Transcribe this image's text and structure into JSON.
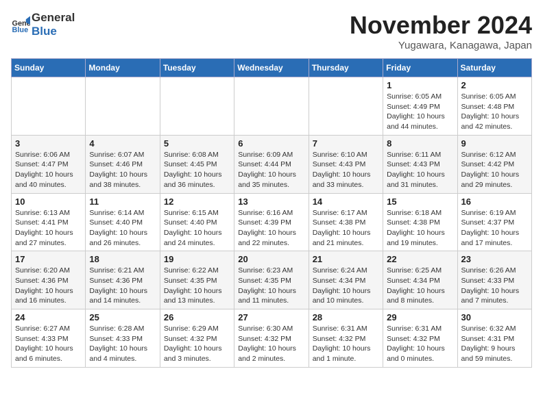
{
  "logo": {
    "line1": "General",
    "line2": "Blue"
  },
  "title": "November 2024",
  "subtitle": "Yugawara, Kanagawa, Japan",
  "days_of_week": [
    "Sunday",
    "Monday",
    "Tuesday",
    "Wednesday",
    "Thursday",
    "Friday",
    "Saturday"
  ],
  "weeks": [
    [
      {
        "day": "",
        "info": ""
      },
      {
        "day": "",
        "info": ""
      },
      {
        "day": "",
        "info": ""
      },
      {
        "day": "",
        "info": ""
      },
      {
        "day": "",
        "info": ""
      },
      {
        "day": "1",
        "info": "Sunrise: 6:05 AM\nSunset: 4:49 PM\nDaylight: 10 hours and 44 minutes."
      },
      {
        "day": "2",
        "info": "Sunrise: 6:05 AM\nSunset: 4:48 PM\nDaylight: 10 hours and 42 minutes."
      }
    ],
    [
      {
        "day": "3",
        "info": "Sunrise: 6:06 AM\nSunset: 4:47 PM\nDaylight: 10 hours and 40 minutes."
      },
      {
        "day": "4",
        "info": "Sunrise: 6:07 AM\nSunset: 4:46 PM\nDaylight: 10 hours and 38 minutes."
      },
      {
        "day": "5",
        "info": "Sunrise: 6:08 AM\nSunset: 4:45 PM\nDaylight: 10 hours and 36 minutes."
      },
      {
        "day": "6",
        "info": "Sunrise: 6:09 AM\nSunset: 4:44 PM\nDaylight: 10 hours and 35 minutes."
      },
      {
        "day": "7",
        "info": "Sunrise: 6:10 AM\nSunset: 4:43 PM\nDaylight: 10 hours and 33 minutes."
      },
      {
        "day": "8",
        "info": "Sunrise: 6:11 AM\nSunset: 4:43 PM\nDaylight: 10 hours and 31 minutes."
      },
      {
        "day": "9",
        "info": "Sunrise: 6:12 AM\nSunset: 4:42 PM\nDaylight: 10 hours and 29 minutes."
      }
    ],
    [
      {
        "day": "10",
        "info": "Sunrise: 6:13 AM\nSunset: 4:41 PM\nDaylight: 10 hours and 27 minutes."
      },
      {
        "day": "11",
        "info": "Sunrise: 6:14 AM\nSunset: 4:40 PM\nDaylight: 10 hours and 26 minutes."
      },
      {
        "day": "12",
        "info": "Sunrise: 6:15 AM\nSunset: 4:40 PM\nDaylight: 10 hours and 24 minutes."
      },
      {
        "day": "13",
        "info": "Sunrise: 6:16 AM\nSunset: 4:39 PM\nDaylight: 10 hours and 22 minutes."
      },
      {
        "day": "14",
        "info": "Sunrise: 6:17 AM\nSunset: 4:38 PM\nDaylight: 10 hours and 21 minutes."
      },
      {
        "day": "15",
        "info": "Sunrise: 6:18 AM\nSunset: 4:38 PM\nDaylight: 10 hours and 19 minutes."
      },
      {
        "day": "16",
        "info": "Sunrise: 6:19 AM\nSunset: 4:37 PM\nDaylight: 10 hours and 17 minutes."
      }
    ],
    [
      {
        "day": "17",
        "info": "Sunrise: 6:20 AM\nSunset: 4:36 PM\nDaylight: 10 hours and 16 minutes."
      },
      {
        "day": "18",
        "info": "Sunrise: 6:21 AM\nSunset: 4:36 PM\nDaylight: 10 hours and 14 minutes."
      },
      {
        "day": "19",
        "info": "Sunrise: 6:22 AM\nSunset: 4:35 PM\nDaylight: 10 hours and 13 minutes."
      },
      {
        "day": "20",
        "info": "Sunrise: 6:23 AM\nSunset: 4:35 PM\nDaylight: 10 hours and 11 minutes."
      },
      {
        "day": "21",
        "info": "Sunrise: 6:24 AM\nSunset: 4:34 PM\nDaylight: 10 hours and 10 minutes."
      },
      {
        "day": "22",
        "info": "Sunrise: 6:25 AM\nSunset: 4:34 PM\nDaylight: 10 hours and 8 minutes."
      },
      {
        "day": "23",
        "info": "Sunrise: 6:26 AM\nSunset: 4:33 PM\nDaylight: 10 hours and 7 minutes."
      }
    ],
    [
      {
        "day": "24",
        "info": "Sunrise: 6:27 AM\nSunset: 4:33 PM\nDaylight: 10 hours and 6 minutes."
      },
      {
        "day": "25",
        "info": "Sunrise: 6:28 AM\nSunset: 4:33 PM\nDaylight: 10 hours and 4 minutes."
      },
      {
        "day": "26",
        "info": "Sunrise: 6:29 AM\nSunset: 4:32 PM\nDaylight: 10 hours and 3 minutes."
      },
      {
        "day": "27",
        "info": "Sunrise: 6:30 AM\nSunset: 4:32 PM\nDaylight: 10 hours and 2 minutes."
      },
      {
        "day": "28",
        "info": "Sunrise: 6:31 AM\nSunset: 4:32 PM\nDaylight: 10 hours and 1 minute."
      },
      {
        "day": "29",
        "info": "Sunrise: 6:31 AM\nSunset: 4:32 PM\nDaylight: 10 hours and 0 minutes."
      },
      {
        "day": "30",
        "info": "Sunrise: 6:32 AM\nSunset: 4:31 PM\nDaylight: 9 hours and 59 minutes."
      }
    ]
  ]
}
